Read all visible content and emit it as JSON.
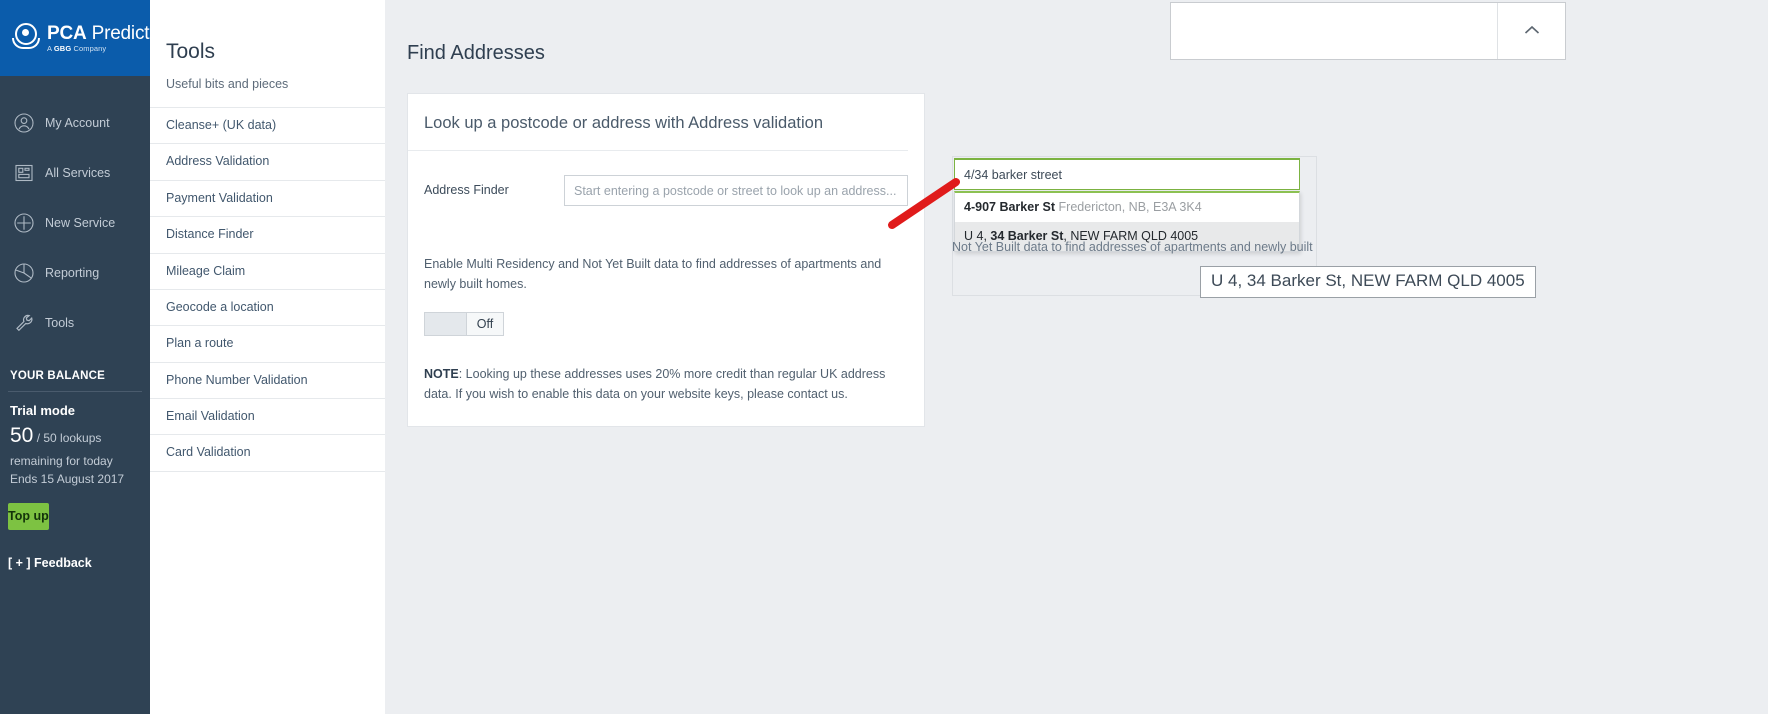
{
  "brand": {
    "name_bold": "PCA",
    "name_light": " Predict",
    "tagline_prefix": "A ",
    "tagline_bold": "GBG",
    "tagline_suffix": " Company",
    "logo_bg": "#0b5cab",
    "sidebar_bg": "#2f4254",
    "accent_green": "#7dc242"
  },
  "sidebar": {
    "items": [
      {
        "label": "My Account",
        "icon": "user-circle-icon"
      },
      {
        "label": "All Services",
        "icon": "grid-panel-icon"
      },
      {
        "label": "New Service",
        "icon": "plus-circle-icon"
      },
      {
        "label": "Reporting",
        "icon": "pie-chart-icon"
      },
      {
        "label": "Tools",
        "icon": "wrench-icon"
      }
    ],
    "balance": {
      "heading": "YOUR BALANCE",
      "mode": "Trial mode",
      "count": "50",
      "count_suffix": " / 50 lookups",
      "remaining": "remaining for today",
      "ends": "Ends 15 August 2017",
      "topup_label": "Top up"
    },
    "feedback_label": "[ + ] Feedback"
  },
  "tools_panel": {
    "title": "Tools",
    "subtitle": "Useful bits and pieces",
    "links": [
      "Cleanse+ (UK data)",
      "Address Validation",
      "Payment Validation",
      "Distance Finder",
      "Mileage Claim",
      "Geocode a location",
      "Plan a route",
      "Phone Number Validation",
      "Email Validation",
      "Card Validation"
    ]
  },
  "main": {
    "page_title": "Find Addresses",
    "card": {
      "heading": "Look up a postcode or address with Address validation",
      "field_label": "Address Finder",
      "field_placeholder": "Start entering a postcode or street to look up an address...",
      "field_value": "",
      "helper_text": "Enable Multi Residency and Not Yet Built data to find addresses of apartments and newly built homes.",
      "toggle_state": "Off",
      "note_label": "NOTE",
      "note_text": ": Looking up these addresses uses 20% more credit than regular UK address data. If you wish to enable this data on your website keys, please contact us."
    }
  },
  "overlay": {
    "collapse_icon": "chevron-up-icon",
    "search_value": "4/34 barker street",
    "suggestions": [
      {
        "bold_part": "4-907 Barker St",
        "muted_part": "Fredericton, NB, E3A 3K4",
        "highlighted": false
      },
      {
        "prefix": "U 4, ",
        "bold_part": "34 Barker St",
        "suffix": ", NEW FARM QLD 4005",
        "highlighted": true
      }
    ],
    "overflow_text": "Not Yet Built data to find addresses of apartments and newly built",
    "callout_text": "U 4, 34 Barker St, NEW FARM QLD 4005",
    "arrow_color": "#e01b1b"
  }
}
